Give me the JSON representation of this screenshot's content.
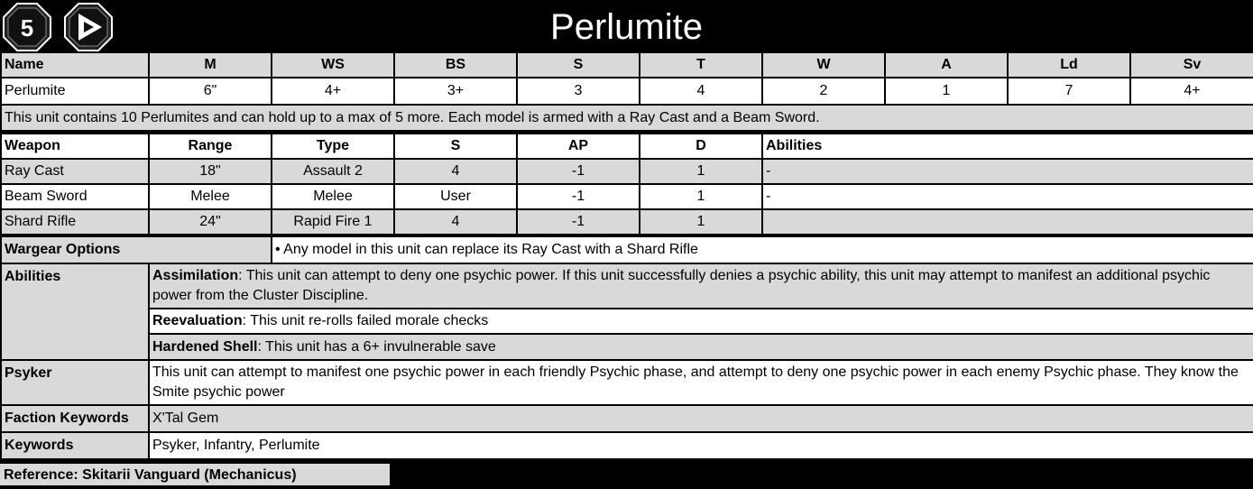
{
  "header": {
    "power_rating": "5",
    "title": "Perlumite"
  },
  "stats": {
    "headers": [
      "Name",
      "M",
      "WS",
      "BS",
      "S",
      "T",
      "W",
      "A",
      "Ld",
      "Sv"
    ],
    "values": [
      "Perlumite",
      "6\"",
      "4+",
      "3+",
      "3",
      "4",
      "2",
      "1",
      "7",
      "4+"
    ]
  },
  "description": "This unit contains 10 Perlumites and can hold up to a max of 5 more. Each model is armed with a Ray Cast and a Beam Sword.",
  "weapons": {
    "headers": [
      "Weapon",
      "Range",
      "Type",
      "S",
      "AP",
      "D",
      "Abilities"
    ],
    "rows": [
      [
        "Ray Cast",
        "18\"",
        "Assault 2",
        "4",
        "-1",
        "1",
        "-"
      ],
      [
        "Beam Sword",
        "Melee",
        "Melee",
        "User",
        "-1",
        "1",
        "-"
      ],
      [
        "Shard Rifle",
        "24\"",
        "Rapid Fire 1",
        "4",
        "-1",
        "1",
        ""
      ]
    ]
  },
  "wargear": {
    "label": "Wargear Options",
    "text": "• Any model in this unit can replace its Ray Cast with a Shard Rifle"
  },
  "abilities": {
    "label": "Abilities",
    "items": [
      {
        "name": "Assimilation",
        "text": ": This unit can attempt to deny one psychic power. If this unit successfully denies a psychic ability, this unit may attempt to manifest an additional psychic power from the Cluster Discipline."
      },
      {
        "name": "Reevaluation",
        "text": ": This unit re-rolls failed morale checks"
      },
      {
        "name": "Hardened Shell",
        "text": ": This unit has a 6+ invulnerable save"
      }
    ]
  },
  "psyker": {
    "label": "Psyker",
    "text": "This unit can attempt to manifest one psychic power in each friendly Psychic phase, and attempt to deny one psychic power in each enemy Psychic phase. They know the Smite psychic power"
  },
  "faction_keywords": {
    "label": "Faction Keywords",
    "text": "X'Tal Gem"
  },
  "keywords": {
    "label": "Keywords",
    "text": "Psyker, Infantry, Perlumite"
  },
  "reference": "Reference: Skitarii Vanguard (Mechanicus)"
}
